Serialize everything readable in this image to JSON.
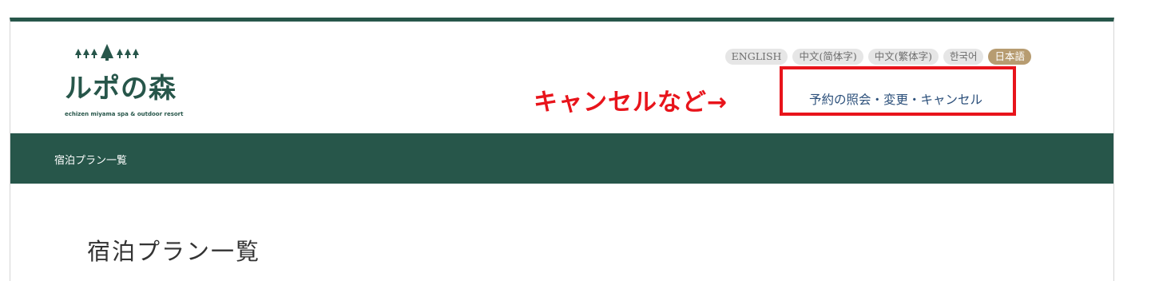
{
  "logo": {
    "script": "ルポの森",
    "tagline": "echizen miyama spa & outdoor resort"
  },
  "languages": [
    {
      "label": "ENGLISH",
      "active": false
    },
    {
      "label": "中文(简体字)",
      "active": false
    },
    {
      "label": "中文(繁体字)",
      "active": false
    },
    {
      "label": "한국어",
      "active": false
    },
    {
      "label": "日本語",
      "active": true
    }
  ],
  "annotation": {
    "text": "キャンセルなど→"
  },
  "reservation_link": "予約の照会・変更・キャンセル",
  "breadcrumb": "宿泊プラン一覧",
  "page_title": "宿泊プラン一覧",
  "colors": {
    "brand_green": "#27564a",
    "active_lang": "#b79c71",
    "annotation_red": "#e8141b",
    "link_blue": "#2b4f7a"
  }
}
